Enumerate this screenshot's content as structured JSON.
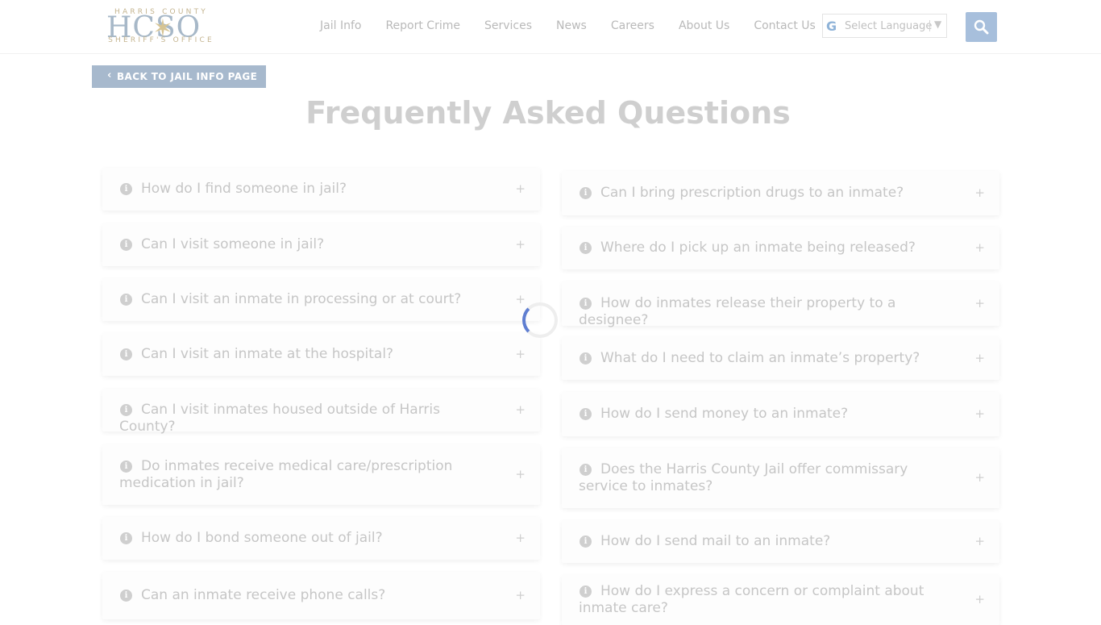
{
  "header": {
    "logo": {
      "top_text": "HARRIS COUNTY",
      "main_text": "HCSO",
      "bottom_text": "SHERIFF'S OFFICE"
    },
    "nav": [
      "Jail Info",
      "Report Crime",
      "Services",
      "News",
      "Careers",
      "About Us",
      "Contact Us"
    ],
    "language_select": {
      "value": "Select Language",
      "g_letter": "G",
      "arrow": "▼"
    },
    "search_icon": "search-icon"
  },
  "back_button": {
    "label": "BACK TO JAIL INFO PAGE",
    "chevron": "‹"
  },
  "page_title": "Frequently Asked Questions",
  "faq_left": [
    "How do I find someone in jail?",
    "Can I visit someone in jail?",
    "Can I visit an inmate in processing or at court?",
    "Can I visit an inmate at the hospital?",
    "Can I visit inmates housed outside of Harris County?",
    "Do inmates receive medical care/prescription medication in jail?",
    "How do I bond someone out of jail?",
    "Can an inmate receive phone calls?"
  ],
  "faq_right": [
    "Can I bring prescription drugs to an inmate?",
    "Where do I pick up an inmate being released?",
    "How do inmates release their property to a designee?",
    "What do I need to claim an inmate’s property?",
    "How do I send money to an inmate?",
    "Does the Harris County Jail offer commissary service to inmates?",
    "How do I send mail to an inmate?",
    "How do I express a concern or complaint about inmate care?"
  ],
  "expand_symbol": "+",
  "info_symbol": "i",
  "colors": {
    "accent": "#a7bfdc",
    "spinner": "#5f7ed1",
    "back_button": "#a7b9cd"
  }
}
